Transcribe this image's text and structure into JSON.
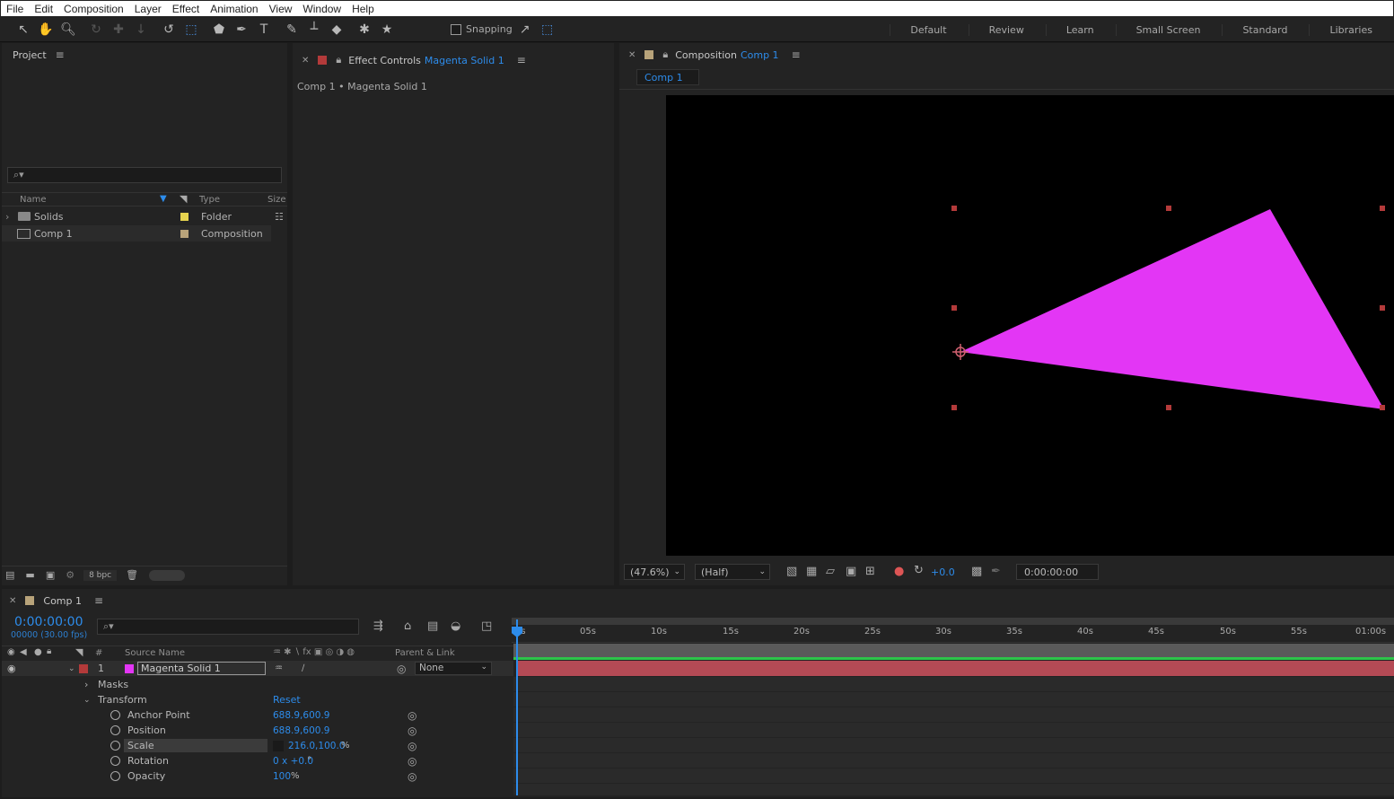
{
  "menu": [
    "File",
    "Edit",
    "Composition",
    "Layer",
    "Effect",
    "Animation",
    "View",
    "Window",
    "Help"
  ],
  "toolbar": {
    "snapping_label": "Snapping",
    "workspaces": [
      "Default",
      "Review",
      "Learn",
      "Small Screen",
      "Standard",
      "Libraries"
    ]
  },
  "project": {
    "title": "Project",
    "columns": {
      "name": "Name",
      "type": "Type",
      "size": "Size"
    },
    "items": [
      {
        "name": "Solids",
        "type": "Folder",
        "label_color": "#e6d34f"
      },
      {
        "name": "Comp 1",
        "type": "Composition",
        "label_color": "#b8a37a"
      }
    ],
    "bpc_label": "8 bpc"
  },
  "effect_controls": {
    "title": "Effect Controls",
    "layer": "Magenta Solid 1",
    "breadcrumb": "Comp 1 • Magenta Solid 1"
  },
  "composition": {
    "title": "Composition",
    "comp_name": "Comp 1",
    "tab": "Comp 1",
    "zoom": "(47.6%)",
    "resolution": "(Half)",
    "exposure": "+0.0",
    "timecode": "0:00:00:00",
    "shape_color": "#e336f5"
  },
  "timeline": {
    "comp_name": "Comp 1",
    "timecode": "0:00:00:00",
    "frame_info": "00000 (30.00 fps)",
    "columns": {
      "source_name": "Source Name",
      "parent": "Parent & Link",
      "num": "#"
    },
    "ruler": [
      "0s",
      "05s",
      "10s",
      "15s",
      "20s",
      "25s",
      "30s",
      "35s",
      "40s",
      "45s",
      "50s",
      "55s",
      "01:00s"
    ],
    "layer": {
      "index": "1",
      "name": "Magenta Solid 1",
      "parent": "None",
      "label_color": "#b33a3a",
      "swatch_color": "#e336f5"
    },
    "groups": {
      "masks": "Masks",
      "transform": "Transform",
      "reset": "Reset"
    },
    "properties": [
      {
        "name": "Anchor Point",
        "value": "688.9,600.9"
      },
      {
        "name": "Position",
        "value": "688.9,600.9"
      },
      {
        "name": "Scale",
        "value": "216.0,100.0",
        "unit": "%"
      },
      {
        "name": "Rotation",
        "value": "0 x +0.0",
        "unit": "°"
      },
      {
        "name": "Opacity",
        "value": "100",
        "unit": "%"
      }
    ]
  }
}
